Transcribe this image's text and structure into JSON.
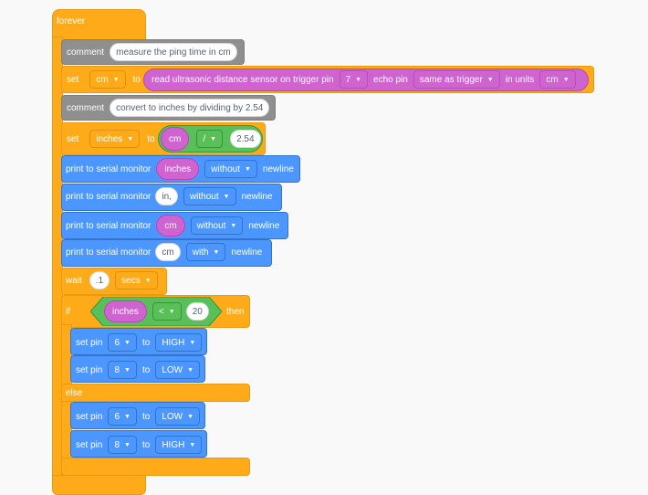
{
  "forever": {
    "label": "forever"
  },
  "comment1": {
    "label": "comment",
    "text": "measure the ping time in cm"
  },
  "set1": {
    "label": "set",
    "var": "cm",
    "to": "to",
    "sensor_label": "read ultrasonic distance sensor on trigger pin",
    "trigger_pin": "7",
    "echo_label": "echo pin",
    "echo_value": "same as trigger",
    "units_label": "in units",
    "units_value": "cm"
  },
  "comment2": {
    "label": "comment",
    "text": "convert to inches by dividing by 2.54"
  },
  "set2": {
    "label": "set",
    "var": "inches",
    "to": "to",
    "operand": "cm",
    "operator": "/",
    "divisor": "2.54"
  },
  "prints": [
    {
      "label": "print to serial monitor",
      "value": "inches",
      "mode": "without",
      "suffix": "newline"
    },
    {
      "label": "print to serial monitor",
      "value": "in,",
      "mode": "without",
      "suffix": "newline"
    },
    {
      "label": "print to serial monitor",
      "value": "cm",
      "mode": "without",
      "suffix": "newline"
    },
    {
      "label": "print to serial monitor",
      "value": "cm",
      "mode": "with",
      "suffix": "newline"
    }
  ],
  "wait": {
    "label": "wait",
    "value": ".1",
    "unit": "secs"
  },
  "if_block": {
    "if_label": "if",
    "var": "inches",
    "op": "<",
    "value": "20",
    "then": "then",
    "else": "else"
  },
  "setpins_if": [
    {
      "label": "set pin",
      "pin": "6",
      "to": "to",
      "level": "HIGH"
    },
    {
      "label": "set pin",
      "pin": "8",
      "to": "to",
      "level": "LOW"
    }
  ],
  "setpins_else": [
    {
      "label": "set pin",
      "pin": "6",
      "to": "to",
      "level": "LOW"
    },
    {
      "label": "set pin",
      "pin": "8",
      "to": "to",
      "level": "HIGH"
    }
  ],
  "colors": {
    "control": "#ffab19",
    "comment": "#8f8f8f",
    "variable": "#cf63cf",
    "output": "#4c97ff",
    "operator": "#59c059"
  }
}
